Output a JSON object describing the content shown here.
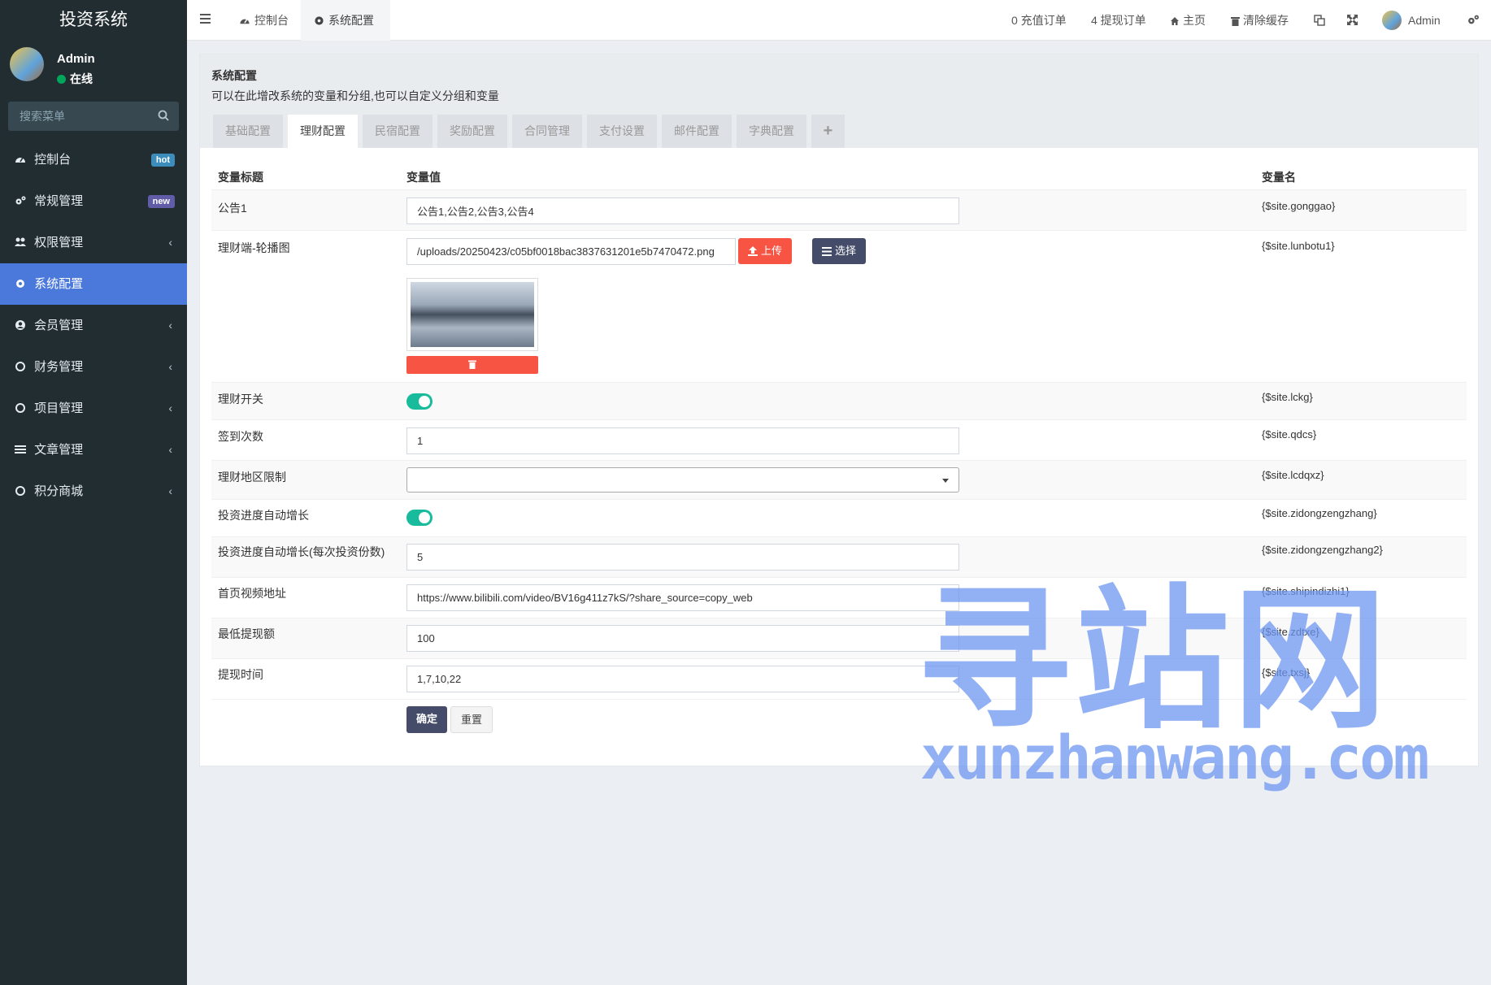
{
  "app": {
    "title": "投资系统"
  },
  "user": {
    "name": "Admin",
    "status": "在线"
  },
  "sidebar": {
    "search_placeholder": "搜索菜单",
    "items": [
      {
        "label": "控制台",
        "icon": "dashboard-icon",
        "badge": "hot"
      },
      {
        "label": "常规管理",
        "icon": "cogs-icon",
        "badge": "new"
      },
      {
        "label": "权限管理",
        "icon": "users-icon",
        "chevron": "‹"
      },
      {
        "label": "系统配置",
        "icon": "gear-icon",
        "active": true
      },
      {
        "label": "会员管理",
        "icon": "user-circle-icon",
        "chevron": "‹"
      },
      {
        "label": "财务管理",
        "icon": "circle-icon",
        "chevron": "‹"
      },
      {
        "label": "项目管理",
        "icon": "circle-icon",
        "chevron": "‹"
      },
      {
        "label": "文章管理",
        "icon": "list-icon",
        "chevron": "‹"
      },
      {
        "label": "积分商城",
        "icon": "circle-icon",
        "chevron": "‹"
      }
    ]
  },
  "header": {
    "tabs": [
      {
        "label": "控制台",
        "icon": "dashboard-icon"
      },
      {
        "label": "系统配置",
        "icon": "gear-icon",
        "active": true
      }
    ],
    "recharge_orders": "0 充值订单",
    "withdraw_orders": "4 提现订单",
    "home": "主页",
    "clear_cache": "清除缓存",
    "user": "Admin"
  },
  "page": {
    "title": "系统配置",
    "description": "可以在此增改系统的变量和分组,也可以自定义分组和变量",
    "tabs": [
      "基础配置",
      "理财配置",
      "民宿配置",
      "奖励配置",
      "合同管理",
      "支付设置",
      "邮件配置",
      "字典配置",
      "+"
    ],
    "active_tab": 1
  },
  "table": {
    "headers": {
      "title": "变量标题",
      "value": "变量值",
      "name": "变量名"
    },
    "rows": [
      {
        "title": "公告1",
        "value": "公告1,公告2,公告3,公告4",
        "name": "{$site.gonggao}"
      },
      {
        "title": "理财端-轮播图",
        "value": "/uploads/20250423/c05bf0018bac3837631201e5b7470472.png",
        "name": "{$site.lunbotu1}",
        "upload_label": "上传",
        "choose_label": "选择"
      },
      {
        "title": "理财开关",
        "value": "on",
        "name": "{$site.lckg}"
      },
      {
        "title": "签到次数",
        "value": "1",
        "name": "{$site.qdcs}"
      },
      {
        "title": "理财地区限制",
        "value": "",
        "name": "{$site.lcdqxz}"
      },
      {
        "title": "投资进度自动增长",
        "value": "on",
        "name": "{$site.zidongzengzhang}"
      },
      {
        "title": "投资进度自动增长(每次投资份数)",
        "value": "5",
        "name": "{$site.zidongzengzhang2}"
      },
      {
        "title": "首页视频地址",
        "value": "https://www.bilibili.com/video/BV16g411z7kS/?share_source=copy_web",
        "name": "{$site.shipindizhi1}"
      },
      {
        "title": "最低提现额",
        "value": "100",
        "name": "{$site.zdtxe}"
      },
      {
        "title": "提现时间",
        "value": "1,7,10,22",
        "name": "{$site.txsj}"
      }
    ]
  },
  "actions": {
    "confirm": "确定",
    "reset": "重置"
  },
  "watermark": {
    "cn": "寻站网",
    "en": "xunzhanwang.com"
  },
  "colors": {
    "sidebar": "#222d32",
    "active": "#4a78db",
    "toggle": "#18bc9c",
    "danger": "#f75444",
    "dark_button": "#444c69"
  }
}
